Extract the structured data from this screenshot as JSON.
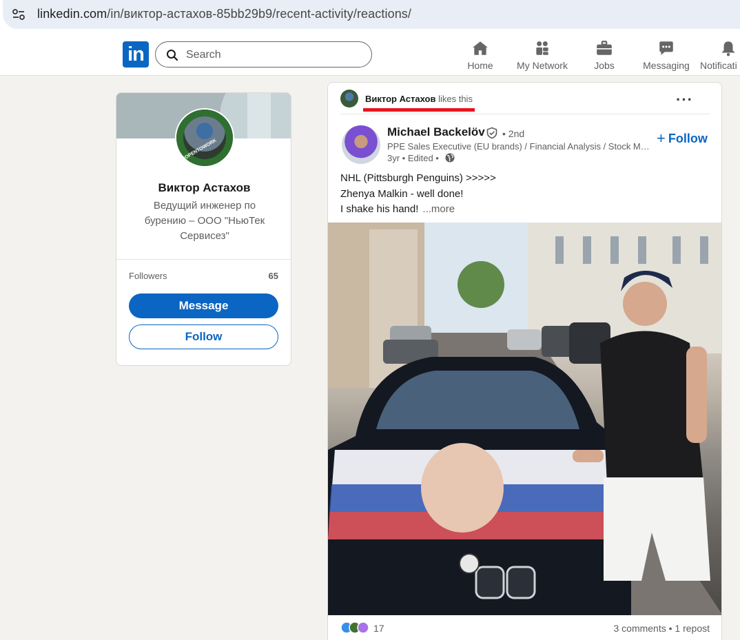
{
  "browser": {
    "url_host": "linkedin.com",
    "url_path": "/in/виктор-астахов-85bb29b9/recent-activity/reactions/"
  },
  "nav": {
    "logo": "in",
    "search_placeholder": "Search",
    "items": [
      {
        "label": "Home",
        "icon": "home-icon"
      },
      {
        "label": "My Network",
        "icon": "network-icon"
      },
      {
        "label": "Jobs",
        "icon": "briefcase-icon"
      },
      {
        "label": "Messaging",
        "icon": "messaging-icon"
      },
      {
        "label": "Notificati",
        "icon": "bell-icon"
      }
    ]
  },
  "profile": {
    "name": "Виктор Астахов",
    "headline": "Ведущий инженер по бурению – ООО \"НьюТек Сервисез\"",
    "followers_label": "Followers",
    "followers_count": "65",
    "message_button": "Message",
    "follow_button": "Follow",
    "badge_text": "#OPENTOWORK"
  },
  "post": {
    "reaction_actor": "Виктор Астахов",
    "reaction_verb": "likes this",
    "menu": "···",
    "author_name": "Michael Backelöv",
    "degree": "• 2nd",
    "author_headline": "PPE Sales Executive (EU brands) / Financial Analysis / Stock Ma...",
    "meta": "3yr • Edited •",
    "follow": "Follow",
    "follow_plus": "+",
    "text_lines": [
      "NHL (Pittsburgh Penguins) >>>>>",
      "Zhenya Malkin - well done!",
      "I shake his hand!"
    ],
    "more": "...more",
    "reaction_count": "17",
    "comments_reposts": "3 comments • 1 repost"
  },
  "colors": {
    "brand": "#0a66c2",
    "annotation": "#e8141e",
    "background": "#f4f2ee"
  }
}
